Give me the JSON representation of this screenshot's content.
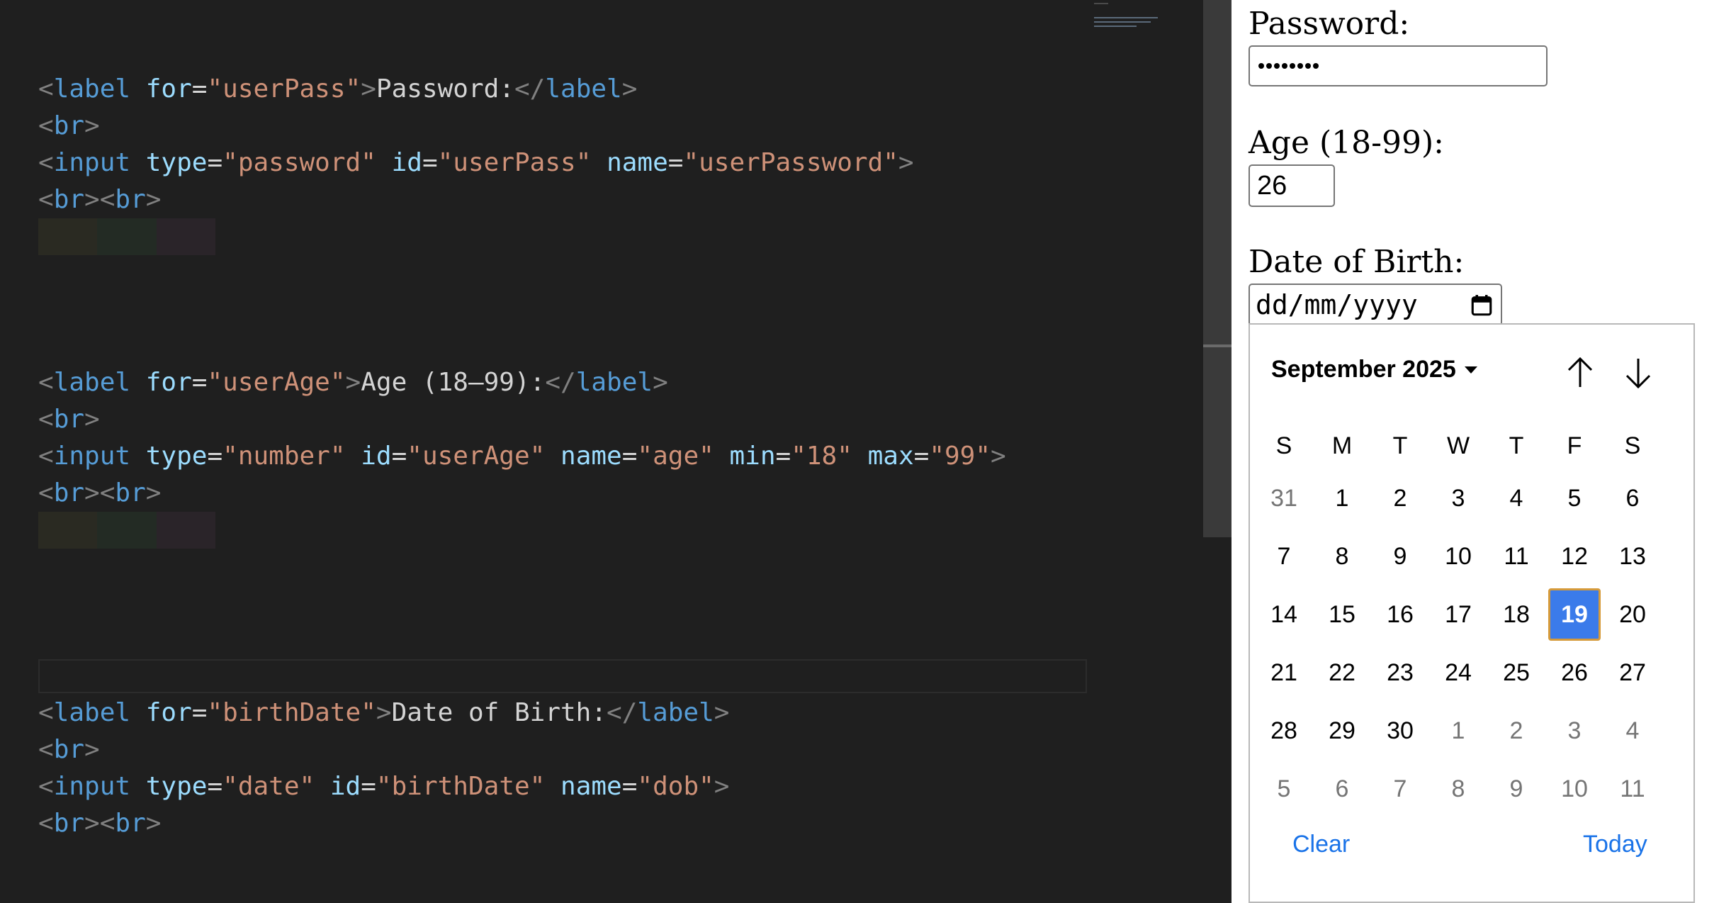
{
  "editor": {
    "password_block": {
      "line1": {
        "open_label": "label",
        "for_attr": "for",
        "for_val": "\"userPass\"",
        "text": "Password:",
        "close_label": "label"
      },
      "line2": {
        "tag": "br"
      },
      "line3": {
        "tag": "input",
        "type_attr": "type",
        "type_val": "\"password\"",
        "id_attr": "id",
        "id_val": "\"userPass\"",
        "name_attr": "name",
        "name_val": "\"userPassword\""
      },
      "line4": {
        "tag1": "br",
        "tag2": "br"
      }
    },
    "age_block": {
      "line1": {
        "open_label": "label",
        "for_attr": "for",
        "for_val": "\"userAge\"",
        "text": "Age (18–99):",
        "close_label": "label"
      },
      "line2": {
        "tag": "br"
      },
      "line3": {
        "tag": "input",
        "type_attr": "type",
        "type_val": "\"number\"",
        "id_attr": "id",
        "id_val": "\"userAge\"",
        "name_attr": "name",
        "name_val": "\"age\"",
        "min_attr": "min",
        "min_val": "\"18\"",
        "max_attr": "max",
        "max_val": "\"99\""
      },
      "line4": {
        "tag1": "br",
        "tag2": "br"
      }
    },
    "date_block": {
      "line1": {
        "open_label": "label",
        "for_attr": "for",
        "for_val": "\"birthDate\"",
        "text": "Date of Birth:",
        "close_label": "label"
      },
      "line2": {
        "tag": "br"
      },
      "line3": {
        "tag": "input",
        "type_attr": "type",
        "type_val": "\"date\"",
        "id_attr": "id",
        "id_val": "\"birthDate\"",
        "name_attr": "name",
        "name_val": "\"dob\""
      },
      "line4": {
        "tag1": "br",
        "tag2": "br"
      }
    },
    "colors": {
      "tag": "#569cd6",
      "attr": "#9cdcfe",
      "string": "#ce9178",
      "text": "#d4d4d4",
      "punct": "#808080",
      "background": "#1f1f1f"
    }
  },
  "preview": {
    "password_label": "Password:",
    "age_label": "Age (18-99):",
    "age_value": "26",
    "dob_label": "Date of Birth:",
    "dob_placeholder": "dd/mm/yyyy",
    "calendar_icon": "calendar-icon"
  },
  "picker": {
    "month_label": "September 2025",
    "nav_icons": [
      "arrow-up-icon",
      "arrow-down-icon"
    ],
    "weekdays": [
      "S",
      "M",
      "T",
      "W",
      "T",
      "F",
      "S"
    ],
    "weeks": [
      [
        "31",
        "1",
        "2",
        "3",
        "4",
        "5",
        "6"
      ],
      [
        "7",
        "8",
        "9",
        "10",
        "11",
        "12",
        "13"
      ],
      [
        "14",
        "15",
        "16",
        "17",
        "18",
        "19",
        "20"
      ],
      [
        "21",
        "22",
        "23",
        "24",
        "25",
        "26",
        "27"
      ],
      [
        "28",
        "29",
        "30",
        "1",
        "2",
        "3",
        "4"
      ],
      [
        "5",
        "6",
        "7",
        "8",
        "9",
        "10",
        "11"
      ]
    ],
    "selected_day": "19",
    "clear_label": "Clear",
    "today_label": "Today",
    "accent_color": "#3b7bea",
    "focus_ring_color": "#d59a3a",
    "link_color": "#1a73e8"
  }
}
